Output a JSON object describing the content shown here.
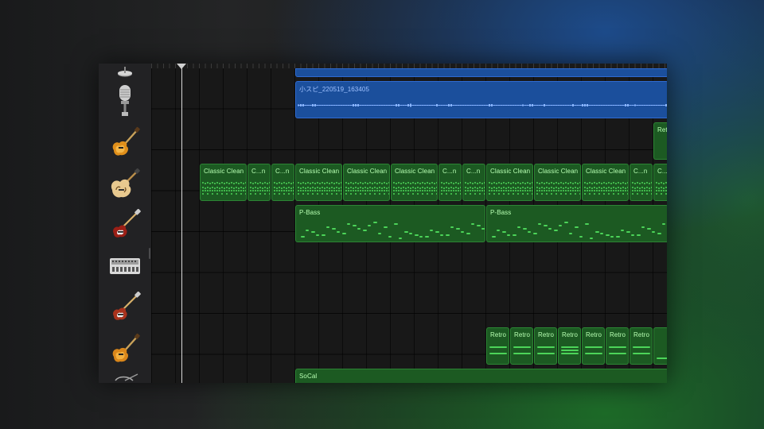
{
  "colors": {
    "audio_region": "#1b4f9c",
    "midi_region": "#1c5a22",
    "midi_note": "#4cd459",
    "playhead": "#d8d8d8"
  },
  "tracks": [
    {
      "icon": "microphone-icon",
      "label": "Audio Recorder"
    },
    {
      "icon": "electric-guitar-icon",
      "label": "Guitar"
    },
    {
      "icon": "hollow-body-guitar-icon",
      "label": "Guitar"
    },
    {
      "icon": "bass-guitar-icon",
      "label": "Bass"
    },
    {
      "icon": "drum-machine-icon",
      "label": "Drum Machine"
    },
    {
      "icon": "bass-guitar-icon",
      "label": "Bass"
    },
    {
      "icon": "electric-guitar-icon",
      "label": "Guitar"
    },
    {
      "icon": "guitar-headstock-icon",
      "label": "Guitar"
    }
  ],
  "regions": {
    "audio_top": {
      "label": ""
    },
    "audio_recording": {
      "label": "小スピ_220519_163405"
    },
    "retro_edge": {
      "label": "Ret"
    },
    "guitar": [
      "Classic Clean",
      "C...n",
      "C...n",
      "Classic Clean",
      "Classic Clean",
      "Classic Clean",
      "C...n",
      "C...n",
      "Classic Clean",
      "Classic Clean",
      "Classic Clean",
      "C...n",
      "C...n"
    ],
    "bass": [
      "P-Bass",
      "P-Bass"
    ],
    "retro": [
      "Retro",
      "Retro",
      "Retro",
      "Retro",
      "Retro",
      "Retro",
      "Retro"
    ],
    "socal": {
      "label": "SoCal"
    }
  }
}
